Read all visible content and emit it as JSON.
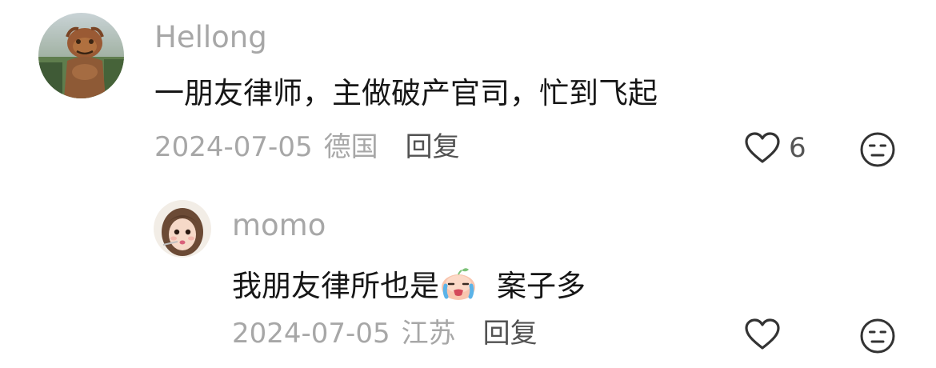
{
  "comment": {
    "username": "Hellong",
    "text": "一朋友律师，主做破产官司，忙到飞起",
    "date": "2024-07-05",
    "location": "德国",
    "reply_label": "回复",
    "like_count": "6",
    "avatar_icon": "lion-statue-avatar",
    "like_icon": "heart-outline-icon",
    "dislike_icon": "meh-face-icon"
  },
  "reply": {
    "username": "momo",
    "text_before_emoji": "我朋友律所也是",
    "emoji_icon": "crying-peach-emoji",
    "text_after_emoji": "案子多",
    "date": "2024-07-05",
    "location": "江苏",
    "reply_label": "回复",
    "avatar_icon": "girl-photo-avatar",
    "like_icon": "heart-outline-icon",
    "dislike_icon": "meh-face-icon"
  },
  "colors": {
    "username": "#a7a7a7",
    "body_text": "#161616",
    "meta_text": "#a7a7a7",
    "reply_text": "#525252",
    "icon_stroke": "#333333"
  }
}
